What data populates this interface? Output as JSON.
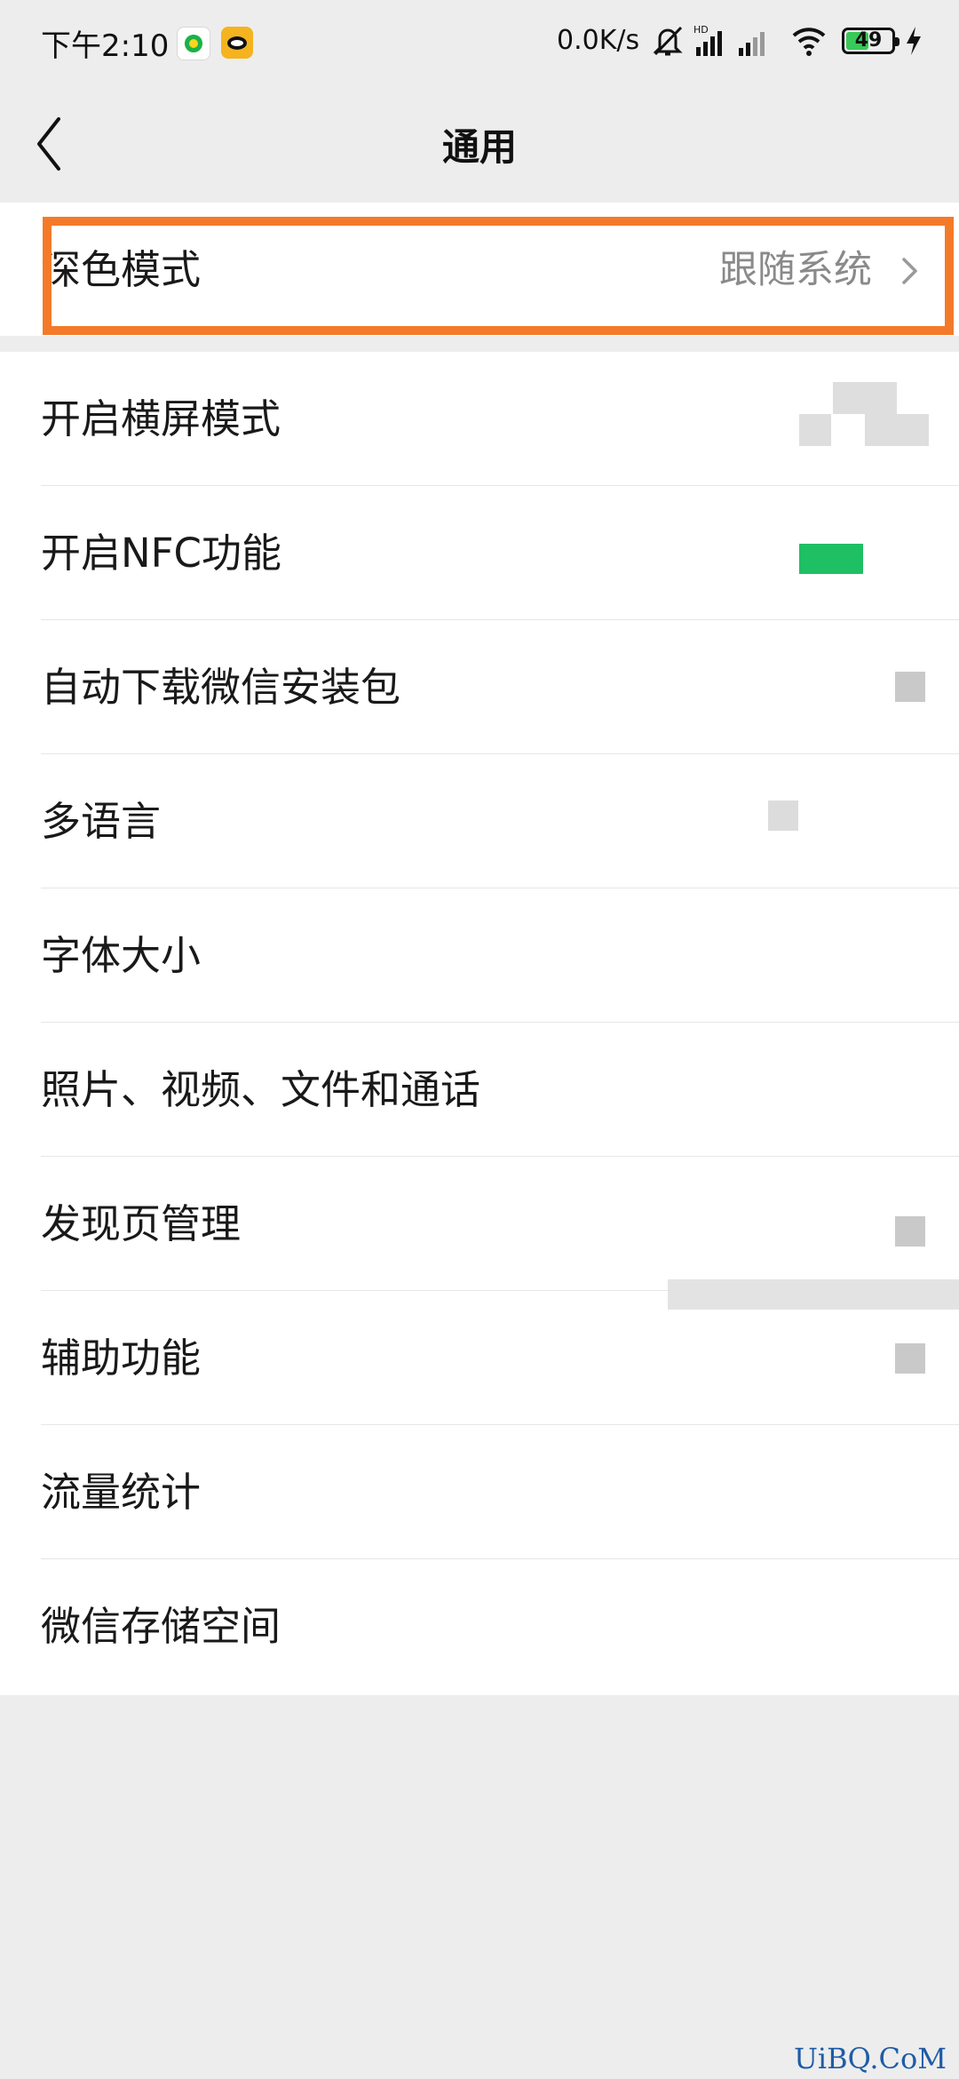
{
  "status_bar": {
    "time": "下午2:10",
    "network_speed": "0.0K/s",
    "signal_label": "HD",
    "battery_percent": "49",
    "battery_level": 0.49,
    "icons": [
      "qq-music-icon",
      "weibo-icon",
      "silent-icon",
      "signal-hd-icon",
      "signal-icon",
      "wifi-icon",
      "battery-icon",
      "charging-icon"
    ]
  },
  "header": {
    "back_icon": "chevron-left-icon",
    "title": "通用"
  },
  "settings": {
    "dark_mode": {
      "label": "深色模式",
      "value": "跟随系统",
      "chevron": "chevron-right-icon"
    },
    "items": [
      {
        "label": "开启横屏模式"
      },
      {
        "label": "开启NFC功能"
      },
      {
        "label": "自动下载微信安装包"
      },
      {
        "label": "多语言"
      },
      {
        "label": "字体大小"
      },
      {
        "label": "照片、视频、文件和通话"
      },
      {
        "label": "发现页管理"
      },
      {
        "label": "辅助功能"
      },
      {
        "label": "流量统计"
      },
      {
        "label": "微信存储空间"
      }
    ]
  },
  "colors": {
    "background": "#ededed",
    "highlight": "#f47a2a",
    "toggle_on": "#1fbf63",
    "text": "#191919",
    "secondary_text": "#8a8a8a"
  },
  "watermark": "UiBQ.CoM"
}
